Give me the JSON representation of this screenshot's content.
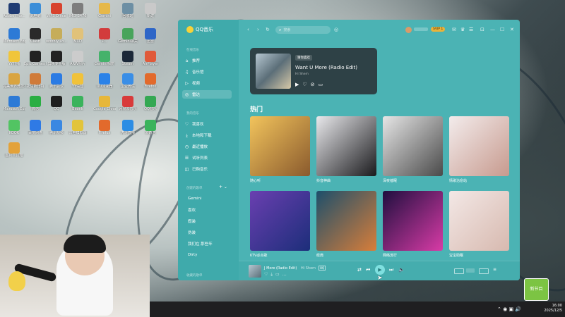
{
  "desktop": {
    "icons": [
      {
        "label": "Adobe Pho...",
        "color": "#1f3b73"
      },
      {
        "label": "此电脑",
        "color": "#3c8ed8"
      },
      {
        "label": "WPS Office",
        "color": "#d8432e"
      },
      {
        "label": "IMG_3476",
        "color": "#7d7d7d"
      },
      {
        "label": "Gemini",
        "color": "#e6b84a"
      },
      {
        "label": "回收站",
        "color": "#6d8fa4"
      },
      {
        "label": "新建",
        "color": "#c9c9c9"
      },
      {
        "label": "Microsoft Edge",
        "color": "#2d7ad6"
      },
      {
        "label": "Clash",
        "color": "#2a2a2a"
      },
      {
        "label": "woobly Lo...",
        "color": "#c6ad5a"
      },
      {
        "label": "MXD",
        "color": "#e1c27a"
      },
      {
        "label": "P...",
        "color": "#d23c3c"
      },
      {
        "label": "Gemini相关",
        "color": "#48a45b"
      },
      {
        "label": "迅雷",
        "color": "#2e66c7"
      },
      {
        "label": "YY开播",
        "color": "#f0c53a"
      },
      {
        "label": "Epic Games Launcher",
        "color": "#222"
      },
      {
        "label": "剪映专业版",
        "color": "#222"
      },
      {
        "label": "ARW图片",
        "color": "#ccc"
      },
      {
        "label": "Gemini相册",
        "color": "#45b26b"
      },
      {
        "label": "Steam",
        "color": "#1b2838"
      },
      {
        "label": "AirPlayer",
        "color": "#e05a3a"
      },
      {
        "label": "完美世界竞技平台",
        "color": "#d9a441"
      },
      {
        "label": "托马斯比特",
        "color": "#d07b3a"
      },
      {
        "label": "腾讯会议",
        "color": "#2b7be4"
      },
      {
        "label": "YY语音",
        "color": "#f1c23a"
      },
      {
        "label": "UU加速器",
        "color": "#2b82e8"
      },
      {
        "label": "企业微信",
        "color": "#3a8ee6"
      },
      {
        "label": "Firefox",
        "color": "#e26a2c"
      },
      {
        "label": "Microsoft Edge",
        "color": "#2d7ad6"
      },
      {
        "label": "微信",
        "color": "#2aae43"
      },
      {
        "label": "QQ",
        "color": "#1f1f1f"
      },
      {
        "label": "Beonk",
        "color": "#3ab35c"
      },
      {
        "label": "Google Chrome",
        "color": "#e7b73a"
      },
      {
        "label": "网易云音乐",
        "color": "#d83a3a"
      },
      {
        "label": "QQ音乐",
        "color": "#34a853"
      },
      {
        "label": "KOOK",
        "color": "#52c463"
      },
      {
        "label": "百度网盘",
        "color": "#2f7ae5"
      },
      {
        "label": "腾讯视频",
        "color": "#3a88e2"
      },
      {
        "label": "雷电模拟器",
        "color": "#e2c43a"
      },
      {
        "label": "Firefox",
        "color": "#e26a2c"
      },
      {
        "label": "虎牙直播",
        "color": "#2c8de4"
      },
      {
        "label": "爱奇艺",
        "color": "#3ab35c"
      },
      {
        "label": "图片工具箱",
        "color": "#e3a23a"
      }
    ]
  },
  "qq": {
    "app_name": "QQ音乐",
    "search_placeholder": "搜索",
    "vip_badge": "SVIP 1",
    "sidebar": {
      "section_online": "在线音乐",
      "items_online": [
        {
          "label": "推荐",
          "icon": "home-icon"
        },
        {
          "label": "音乐馆",
          "icon": "music-hall-icon"
        },
        {
          "label": "视频",
          "icon": "video-icon"
        },
        {
          "label": "雷达",
          "icon": "radar-icon"
        }
      ],
      "section_mine": "我的音乐",
      "items_mine": [
        {
          "label": "我喜欢",
          "icon": "heart-icon"
        },
        {
          "label": "本地和下载",
          "icon": "download-icon"
        },
        {
          "label": "最近播放",
          "icon": "history-icon"
        },
        {
          "label": "试听列表",
          "icon": "list-icon"
        },
        {
          "label": "已购音乐",
          "icon": "bag-icon"
        }
      ],
      "section_created": "创建的歌单",
      "playlists": [
        "Gemini",
        "喜欢",
        "假装",
        "伪装",
        "我们在·那些年",
        "Dirty"
      ],
      "section_collected": "收藏的歌单"
    },
    "now_playing_card": {
      "tag": "猜你喜欢",
      "title": "Want U More (Radio Edit)",
      "artist": "Hi Shem"
    },
    "section_title": "热门",
    "grid": [
      {
        "caption": "随心听",
        "colors": [
          "#f2c45c",
          "#8a5a2d"
        ]
      },
      {
        "caption": "抖音神曲",
        "colors": [
          "#e9e9ec",
          "#1a1a1d"
        ]
      },
      {
        "caption": "深夜催眠",
        "colors": [
          "#e6e6e6",
          "#4a4a4a"
        ]
      },
      {
        "caption": "情歌治愈站",
        "colors": [
          "#f3ecec",
          "#c79a8e"
        ]
      },
      {
        "caption": "KTV必点歌",
        "colors": [
          "#6a3fb0",
          "#1c2e7a"
        ]
      },
      {
        "caption": "经典",
        "colors": [
          "#1d4f6b",
          "#d87e3a"
        ]
      },
      {
        "caption": "网络流行",
        "colors": [
          "#1f0f3f",
          "#d83ba6"
        ]
      },
      {
        "caption": "宝宝助眠",
        "colors": [
          "#f3e8e6",
          "#d7b9af"
        ]
      }
    ],
    "player": {
      "title": "J More (Radio Edit)",
      "artist": "Hi Shem",
      "quality": "HQ"
    }
  },
  "taskbar": {
    "time": "16:00",
    "date": "2025/12/5"
  },
  "overlay_badge": "新节目"
}
